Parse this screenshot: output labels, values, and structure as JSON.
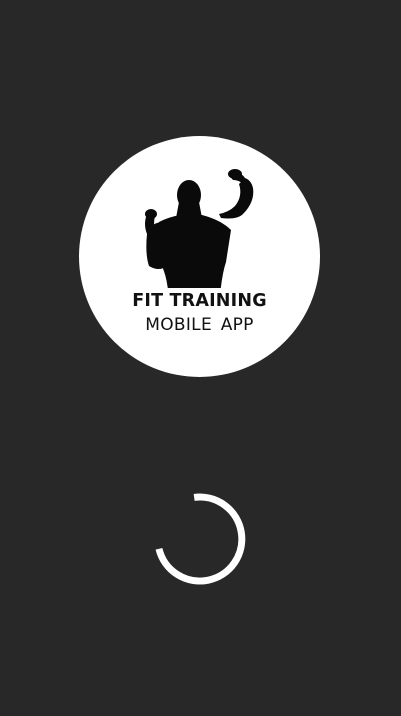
{
  "app": {
    "logo_title": "FIT TRAINING",
    "logo_subtitle": "MOBILE  APP"
  },
  "colors": {
    "background": "#282828",
    "logo_circle": "#ffffff",
    "logo_ink": "#111111",
    "spinner": "#ffffff"
  },
  "icons": {
    "logo": "bodybuilder-flexing-icon",
    "loader": "loading-spinner-icon"
  }
}
